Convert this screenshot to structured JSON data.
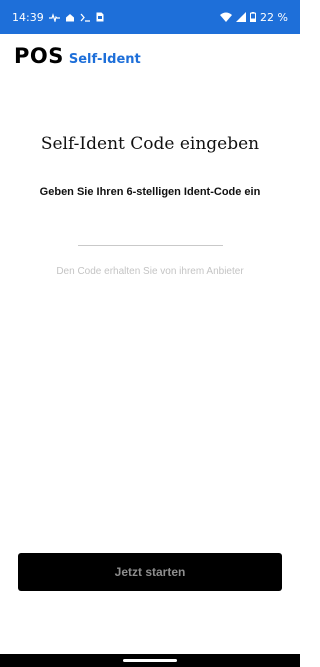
{
  "status_bar": {
    "time": "14:39",
    "battery": "22 %",
    "icons": [
      "pulse-icon",
      "home-icon",
      "terminal-icon",
      "sim-icon",
      "wifi-icon",
      "signal-icon",
      "battery-icon"
    ]
  },
  "brand": {
    "name": "POS",
    "subtitle": "Self-Ident",
    "accent_color": "#1e6fd9"
  },
  "main": {
    "title": "Self-Ident Code eingeben",
    "subtitle": "Geben Sie Ihren 6-stelligen Ident-Code ein",
    "code_input": {
      "value": "",
      "placeholder": ""
    },
    "hint": "Den Code erhalten Sie von ihrem Anbieter"
  },
  "actions": {
    "start_label": "Jetzt starten"
  }
}
